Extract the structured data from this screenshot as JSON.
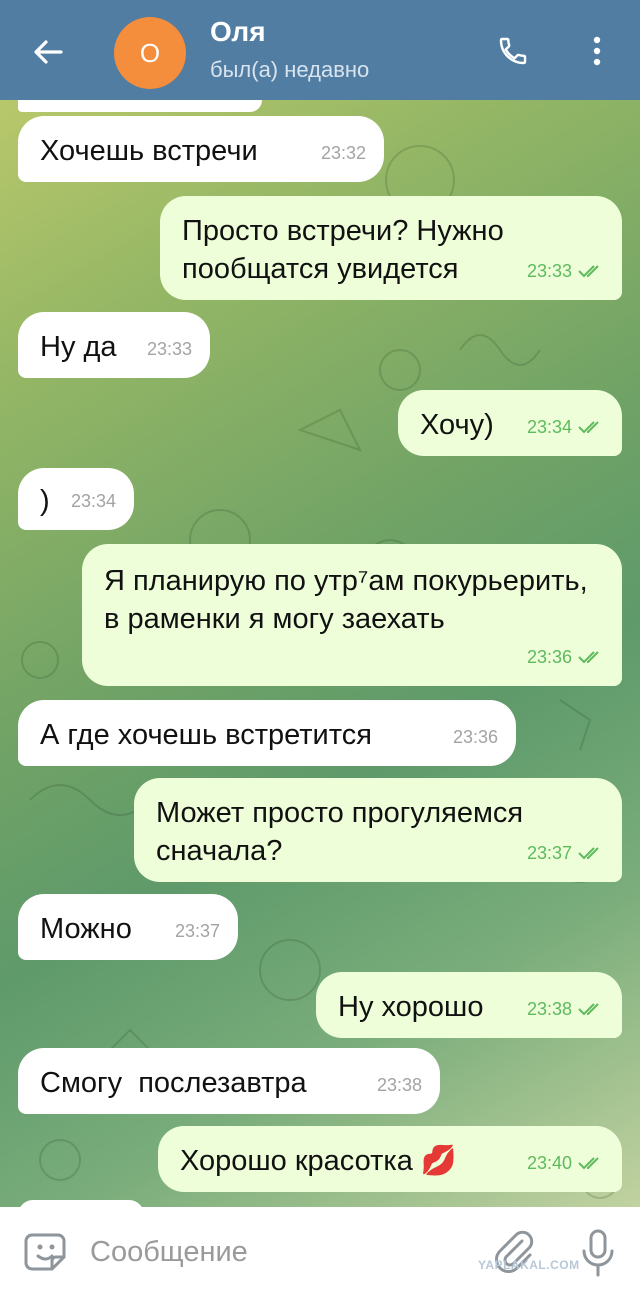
{
  "header": {
    "avatar_letter": "О",
    "contact_name": "Оля",
    "status": "был(а) недавно"
  },
  "messages": [
    {
      "dir": "in",
      "text": "Хочешь встречи",
      "time": "23:32"
    },
    {
      "dir": "out",
      "text": "Просто встречи? Нужно пообщатся увидется",
      "time": "23:33",
      "read": true
    },
    {
      "dir": "in",
      "text": "Ну да",
      "time": "23:33"
    },
    {
      "dir": "out",
      "text": "Хочу)",
      "time": "23:34",
      "read": true
    },
    {
      "dir": "in",
      "text": ")",
      "time": "23:34"
    },
    {
      "dir": "out",
      "text": "Я планирую по утр⁷ам покурьерить, в раменки я могу заехать",
      "time": "23:36",
      "read": true
    },
    {
      "dir": "in",
      "text": "А где хочешь встретится",
      "time": "23:36"
    },
    {
      "dir": "out",
      "text": "Может просто прогуляемся сначала?",
      "time": "23:37",
      "read": true
    },
    {
      "dir": "in",
      "text": "Можно",
      "time": "23:37"
    },
    {
      "dir": "out",
      "text": "Ну хорошо",
      "time": "23:38",
      "read": true
    },
    {
      "dir": "in",
      "text": "Смогу  послезавтра",
      "time": "23:38"
    },
    {
      "dir": "out",
      "text": "Хорошо красотка 💋",
      "time": "23:40",
      "read": true
    }
  ],
  "composer": {
    "placeholder": "Сообщение"
  },
  "watermark": "YAPLAKAL.COM",
  "colors": {
    "header": "#527da3",
    "incoming_bubble": "#ffffff",
    "outgoing_bubble": "#eefed9",
    "read_check": "#5dba5d",
    "avatar": "#f48d3c"
  }
}
